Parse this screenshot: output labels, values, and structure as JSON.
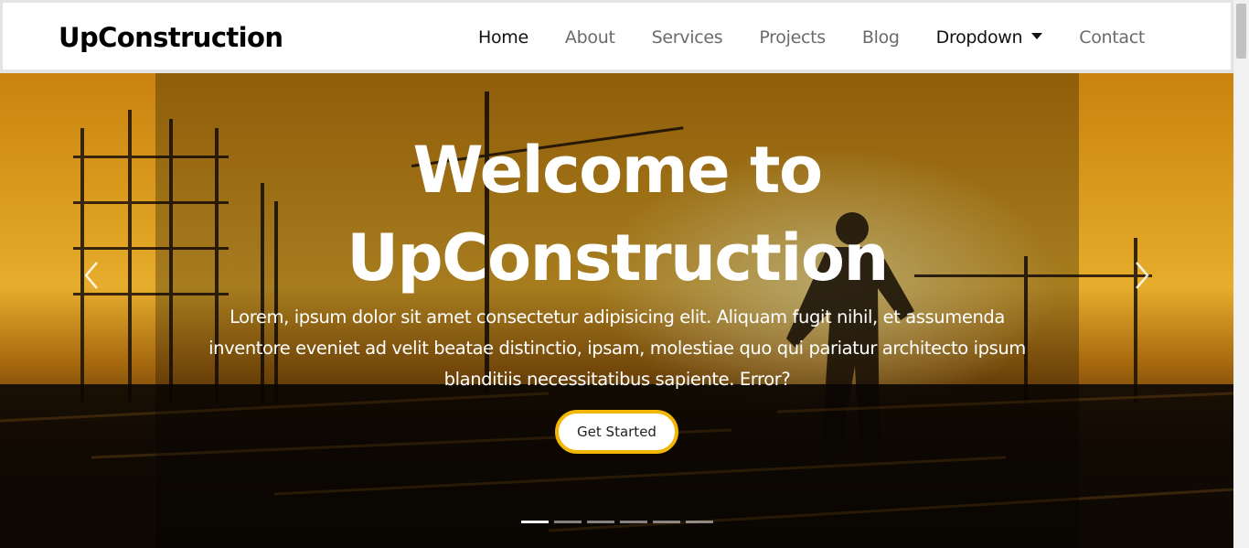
{
  "brand": {
    "name": "UpConstruction"
  },
  "nav": {
    "items": [
      {
        "label": "Home"
      },
      {
        "label": "About"
      },
      {
        "label": "Services"
      },
      {
        "label": "Projects"
      },
      {
        "label": "Blog"
      },
      {
        "label": "Dropdown"
      },
      {
        "label": "Contact"
      }
    ],
    "active": "Home"
  },
  "hero": {
    "title_line1": "Welcome to",
    "title_line2": "UpConstruction",
    "text": "Lorem, ipsum dolor sit amet consectetur adipisicing elit. Aliquam fugit nihil, et assumenda inventore eveniet ad velit beatae distinctio, ipsam, molestiae quo qui pariatur architecto ipsum blanditiis necessitatibus sapiente. Error?",
    "cta_label": "Get Started",
    "slide_count": 6,
    "active_slide": 1,
    "prev_icon": "chevron-left-icon",
    "next_icon": "chevron-right-icon"
  },
  "colors": {
    "accent": "#f2b705",
    "nav_text": "#6b6b6b",
    "nav_active": "#111111"
  }
}
